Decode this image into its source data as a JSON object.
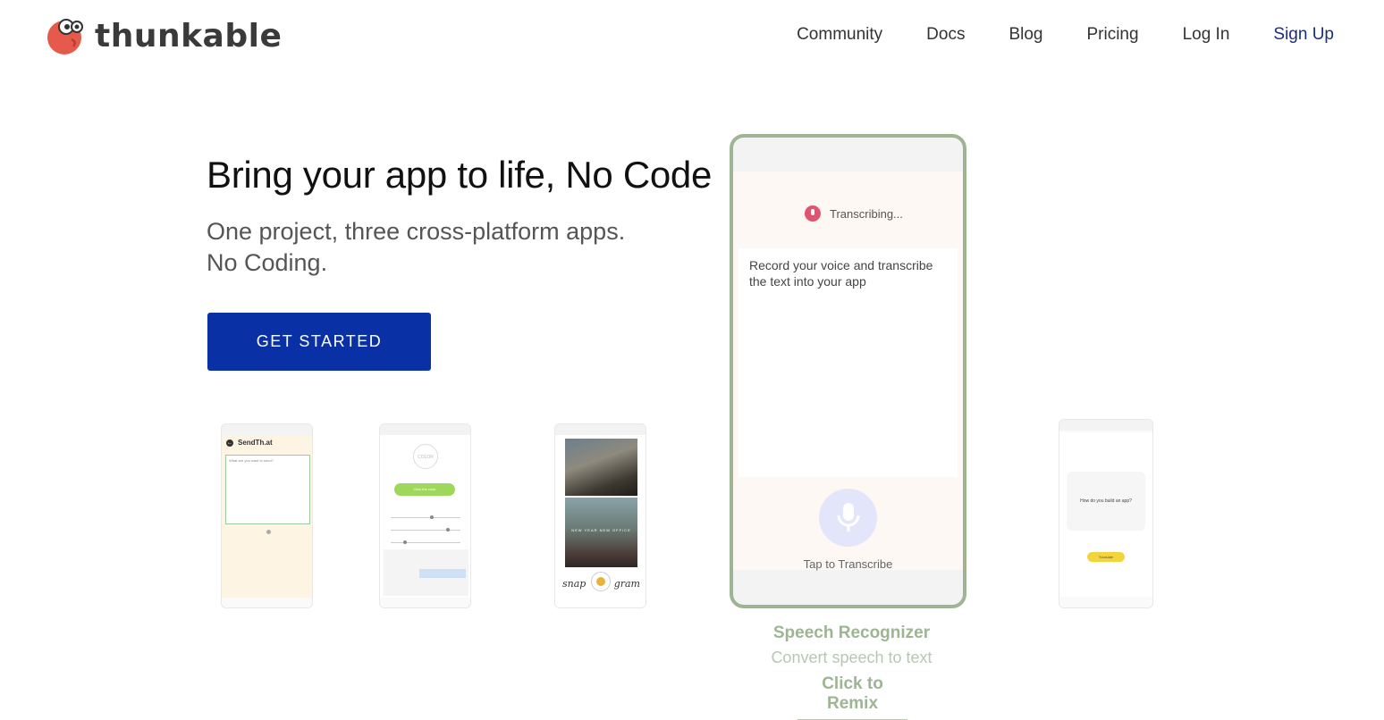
{
  "brand": {
    "name": "thunkable"
  },
  "nav": [
    {
      "label": "Community"
    },
    {
      "label": "Docs"
    },
    {
      "label": "Blog"
    },
    {
      "label": "Pricing"
    },
    {
      "label": "Log In"
    },
    {
      "label": "Sign Up"
    }
  ],
  "hero": {
    "title": "Bring your app to life, No Code",
    "subtitle_line1": "One project, three cross-platform apps.",
    "subtitle_line2": "No Coding.",
    "cta_label": "GET STARTED"
  },
  "phones": {
    "sendthat": {
      "title": "SendTh.at",
      "prompt": "What are you want to send?"
    },
    "color": {
      "circle_label": "COLOR",
      "button_label": "Click the color"
    },
    "snapgram": {
      "photo_caption": "NEW YEAR NEW OFFICE",
      "left_word": "snap",
      "right_word": "gram"
    },
    "speech": {
      "status": "Transcribing...",
      "body": "Record your voice and transcribe the text into your app",
      "tap_label": "Tap to Transcribe"
    },
    "translate": {
      "question": "How do you build an app?",
      "button_label": "Translate"
    }
  },
  "featured": {
    "title": "Speech Recognizer",
    "description": "Convert speech to text",
    "link_label": "Click to Remix"
  },
  "colors": {
    "primary": "#0a30a5",
    "signup": "#1a2f7a",
    "accent_green": "#9db592",
    "mic_red": "#e0546f",
    "logo_red": "#e65a4b"
  }
}
